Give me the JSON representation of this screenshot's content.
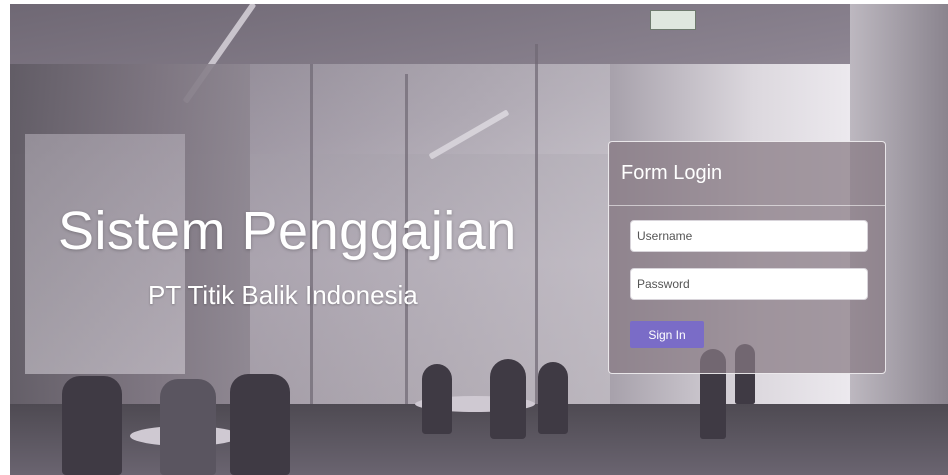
{
  "hero": {
    "title": "Sistem Penggajian",
    "subtitle": "PT Titik Balik Indonesia"
  },
  "login": {
    "title": "Form Login",
    "username_placeholder": "Username",
    "password_placeholder": "Password",
    "signin_label": "Sign In"
  },
  "colors": {
    "button": "#7a6cc7",
    "panel": "rgba(135,120,130,0.72)",
    "text": "#ffffff"
  },
  "icons": {
    "background": "office-background-image"
  }
}
